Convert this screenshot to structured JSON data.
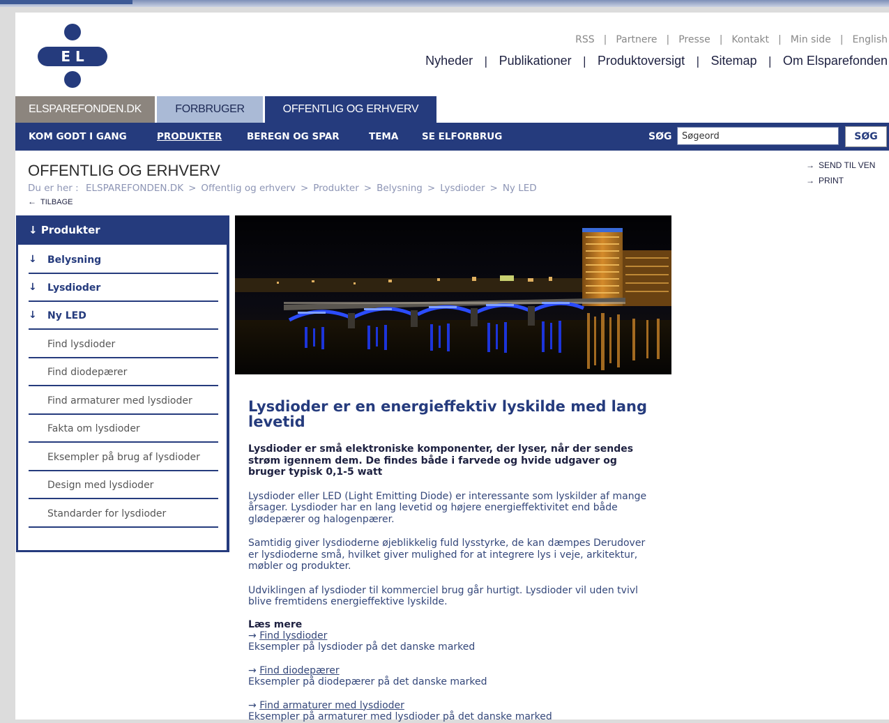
{
  "top_links": [
    "RSS",
    "Partnere",
    "Presse",
    "Kontakt",
    "Min side",
    "English"
  ],
  "main_links": [
    "Nyheder",
    "Publikationer",
    "Produktoversigt",
    "Sitemap",
    "Om Elsparefonden"
  ],
  "logo_text": "E L",
  "tabs": [
    "ELSPAREFONDEN.DK",
    "FORBRUGER",
    "OFFENTLIG OG ERHVERV"
  ],
  "nav": {
    "items": [
      "KOM GODT I GANG",
      "PRODUKTER",
      "BEREGN OG SPAR",
      "TEMA",
      "SE ELFORBRUG"
    ],
    "search_label": "SØG",
    "search_value": "Søgeord",
    "search_button": "SØG"
  },
  "page_title": "OFFENTLIG OG ERHVERV",
  "breadcrumb": {
    "prefix": "Du er her :",
    "items": [
      "ELSPAREFONDEN.DK",
      "Offentlig og erhverv",
      "Produkter",
      "Belysning",
      "Lysdioder",
      "Ny LED"
    ]
  },
  "back_label": "TILBAGE",
  "utility": {
    "send": "SEND TIL VEN",
    "print": "PRINT"
  },
  "sidebar": {
    "title": "Produkter",
    "levels": [
      "Belysning",
      "Lysdioder",
      "Ny LED"
    ],
    "subs": [
      "Find lysdioder",
      "Find diodepærer",
      "Find armaturer med lysdioder",
      "Fakta om lysdioder",
      "Eksempler på brug af lysdioder",
      "Design med lysdioder",
      "Standarder for lysdioder"
    ]
  },
  "article": {
    "heading": "Lysdioder er en energieffektiv lyskilde med lang levetid",
    "lead": "Lysdioder er små elektroniske komponenter, der lyser, når der sendes strøm igennem dem. De findes både i farvede og hvide udgaver og bruger typisk 0,1-5 watt",
    "paragraphs": [
      "Lysdioder eller LED (Light Emitting Diode) er interessante som lyskilder af mange årsager. Lysdioder har en lang levetid og højere energieffektivitet end både glødepærer og halogenpærer.",
      "Samtidig giver lysdioderne øjeblikkelig fuld lysstyrke, de kan dæmpes Derudover er lysdioderne små, hvilket giver mulighed for at integrere lys i veje, arkitektur, møbler og produkter.",
      "Udviklingen af lysdioder til kommerciel brug går hurtigt. Lysdioder vil uden tvivl blive fremtidens energieffektive lyskilde."
    ],
    "read_more_title": "Læs mere",
    "read_more": [
      {
        "link": "Find lysdioder",
        "desc": "Eksempler på lysdioder på det danske marked"
      },
      {
        "link": "Find diodepærer",
        "desc": "Eksempler på diodepærer på det danske marked"
      },
      {
        "link": "Find armaturer med lysdioder",
        "desc": "Eksempler på armaturer med lysdioder på det danske marked"
      }
    ]
  },
  "colors": {
    "brand_blue": "#253b7d",
    "tab_grey": "#8c857e",
    "tab_light": "#aabad6"
  }
}
